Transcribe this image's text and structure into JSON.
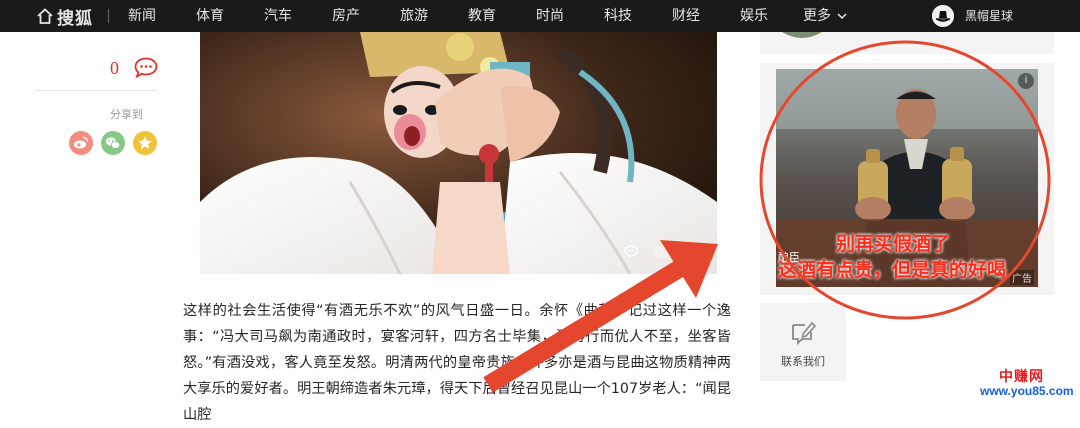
{
  "nav": {
    "logo_text": "搜狐",
    "items": [
      "新闻",
      "体育",
      "汽车",
      "房产",
      "旅游",
      "教育",
      "时尚",
      "科技",
      "财经",
      "娱乐",
      "更多"
    ],
    "user_name": "黑帽星球"
  },
  "share": {
    "comment_count": "0",
    "share_label": "分享到",
    "buttons": [
      "weibo-icon",
      "wechat-icon",
      "qzone-icon"
    ]
  },
  "photo": {
    "watermark": "戏曲日报"
  },
  "article": {
    "text": "这样的社会生活使得“有酒无乐不欢”的风气日盛一日。余怀《曲苑》记过这样一个逸事：“冯大司马飙为南通政时，宴客河轩，四方名士毕集，酒再行而优人不至，坐客皆怒。”有酒没戏，客人竟至发怒。明清两代的皇帝贵族，许多亦是酒与昆曲这物质精神两大享乐的爱好者。明王朝缔造者朱元璋，得天下后曾经召见昆山一个107岁老人：“闻昆山腔"
  },
  "ad": {
    "line1": "别再买假酒了",
    "line2": "这酒有点贵，但是真的好喝",
    "tag": "广告",
    "side_text": "酿臣"
  },
  "contact": {
    "label": "联系我们"
  },
  "watermark": {
    "title": "中赚网",
    "url": "www.you85.com"
  },
  "colors": {
    "nav_bg": "#1a1a1a",
    "accent_red": "#e0322a",
    "annotation": "#e5472e"
  }
}
